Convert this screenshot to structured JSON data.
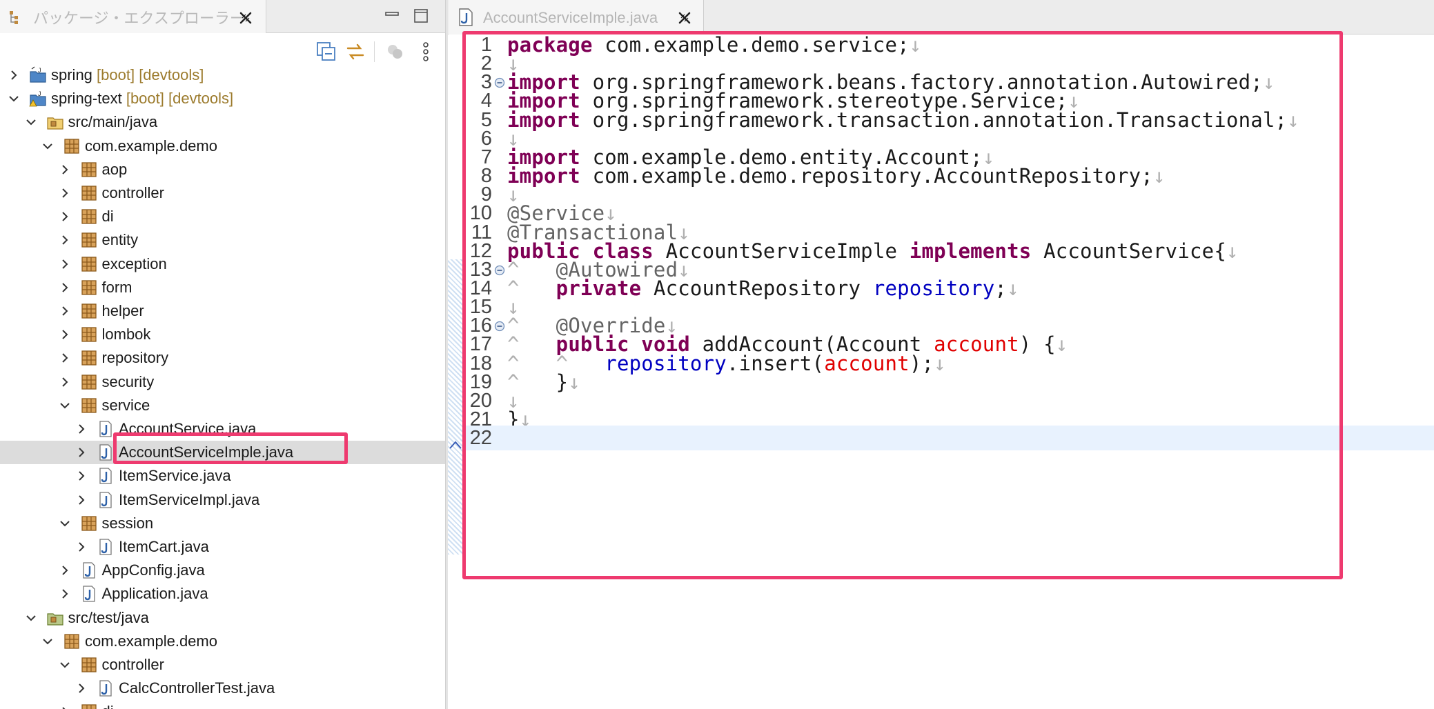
{
  "explorer": {
    "tab_title": "パッケージ・エクスプローラー",
    "tree": [
      {
        "label": "spring",
        "decor": " [boot] [devtools]",
        "indent": 0,
        "state": "collapsed",
        "icon": "project-icon",
        "kind": "project"
      },
      {
        "label": "spring-text",
        "decor": " [boot] [devtools]",
        "indent": 0,
        "state": "expanded",
        "icon": "project-warning-icon",
        "kind": "project"
      },
      {
        "label": "src/main/java",
        "decor": "",
        "indent": 1,
        "state": "expanded",
        "icon": "source-folder-icon",
        "kind": "folder"
      },
      {
        "label": "com.example.demo",
        "decor": "",
        "indent": 2,
        "state": "expanded",
        "icon": "package-icon",
        "kind": "package"
      },
      {
        "label": "aop",
        "decor": "",
        "indent": 3,
        "state": "collapsed",
        "icon": "package-icon",
        "kind": "package"
      },
      {
        "label": "controller",
        "decor": "",
        "indent": 3,
        "state": "collapsed",
        "icon": "package-icon",
        "kind": "package"
      },
      {
        "label": "di",
        "decor": "",
        "indent": 3,
        "state": "collapsed",
        "icon": "package-icon",
        "kind": "package"
      },
      {
        "label": "entity",
        "decor": "",
        "indent": 3,
        "state": "collapsed",
        "icon": "package-icon",
        "kind": "package"
      },
      {
        "label": "exception",
        "decor": "",
        "indent": 3,
        "state": "collapsed",
        "icon": "package-icon",
        "kind": "package"
      },
      {
        "label": "form",
        "decor": "",
        "indent": 3,
        "state": "collapsed",
        "icon": "package-icon",
        "kind": "package"
      },
      {
        "label": "helper",
        "decor": "",
        "indent": 3,
        "state": "collapsed",
        "icon": "package-icon",
        "kind": "package"
      },
      {
        "label": "lombok",
        "decor": "",
        "indent": 3,
        "state": "collapsed",
        "icon": "package-icon",
        "kind": "package"
      },
      {
        "label": "repository",
        "decor": "",
        "indent": 3,
        "state": "collapsed",
        "icon": "package-icon",
        "kind": "package"
      },
      {
        "label": "security",
        "decor": "",
        "indent": 3,
        "state": "collapsed",
        "icon": "package-icon",
        "kind": "package"
      },
      {
        "label": "service",
        "decor": "",
        "indent": 3,
        "state": "expanded",
        "icon": "package-icon",
        "kind": "package"
      },
      {
        "label": "AccountService.java",
        "decor": "",
        "indent": 4,
        "state": "collapsed",
        "icon": "java-file-icon",
        "kind": "file"
      },
      {
        "label": "AccountServiceImple.java",
        "decor": "",
        "indent": 4,
        "state": "collapsed",
        "icon": "java-file-icon",
        "kind": "file",
        "selected": true
      },
      {
        "label": "ItemService.java",
        "decor": "",
        "indent": 4,
        "state": "collapsed",
        "icon": "java-file-icon",
        "kind": "file"
      },
      {
        "label": "ItemServiceImpl.java",
        "decor": "",
        "indent": 4,
        "state": "collapsed",
        "icon": "java-file-icon",
        "kind": "file"
      },
      {
        "label": "session",
        "decor": "",
        "indent": 3,
        "state": "expanded",
        "icon": "package-icon",
        "kind": "package"
      },
      {
        "label": "ItemCart.java",
        "decor": "",
        "indent": 4,
        "state": "collapsed",
        "icon": "java-file-icon",
        "kind": "file"
      },
      {
        "label": "AppConfig.java",
        "decor": "",
        "indent": 3,
        "state": "collapsed",
        "icon": "java-file-icon",
        "kind": "file"
      },
      {
        "label": "Application.java",
        "decor": "",
        "indent": 3,
        "state": "collapsed",
        "icon": "java-file-icon",
        "kind": "file"
      },
      {
        "label": "src/test/java",
        "decor": "",
        "indent": 1,
        "state": "expanded",
        "icon": "test-folder-icon",
        "kind": "folder"
      },
      {
        "label": "com.example.demo",
        "decor": "",
        "indent": 2,
        "state": "expanded",
        "icon": "package-icon",
        "kind": "package"
      },
      {
        "label": "controller",
        "decor": "",
        "indent": 3,
        "state": "expanded",
        "icon": "package-icon",
        "kind": "package"
      },
      {
        "label": "CalcControllerTest.java",
        "decor": "",
        "indent": 4,
        "state": "collapsed",
        "icon": "java-file-icon",
        "kind": "file"
      },
      {
        "label": "di",
        "decor": "",
        "indent": 3,
        "state": "collapsed",
        "icon": "package-icon",
        "kind": "package"
      }
    ]
  },
  "editor": {
    "tab_title": "AccountServiceImple.java",
    "current_line": 22,
    "lines": [
      {
        "n": "1",
        "fold": false,
        "tokens": [
          [
            "keyword",
            "package"
          ],
          [
            "plain",
            " com.example.demo.service;"
          ],
          [
            "ws",
            "↓"
          ]
        ]
      },
      {
        "n": "2",
        "fold": false,
        "tokens": [
          [
            "ws",
            "↓"
          ]
        ]
      },
      {
        "n": "3",
        "fold": true,
        "tokens": [
          [
            "keyword",
            "import"
          ],
          [
            "plain",
            " org.springframework.beans.factory.annotation.Autowired;"
          ],
          [
            "ws",
            "↓"
          ]
        ]
      },
      {
        "n": "4",
        "fold": false,
        "tokens": [
          [
            "keyword",
            "import"
          ],
          [
            "plain",
            " org.springframework.stereotype.Service;"
          ],
          [
            "ws",
            "↓"
          ]
        ]
      },
      {
        "n": "5",
        "fold": false,
        "tokens": [
          [
            "keyword",
            "import"
          ],
          [
            "plain",
            " org.springframework.transaction.annotation.Transactional;"
          ],
          [
            "ws",
            "↓"
          ]
        ]
      },
      {
        "n": "6",
        "fold": false,
        "tokens": [
          [
            "ws",
            "↓"
          ]
        ]
      },
      {
        "n": "7",
        "fold": false,
        "tokens": [
          [
            "keyword",
            "import"
          ],
          [
            "plain",
            " com.example.demo.entity.Account;"
          ],
          [
            "ws",
            "↓"
          ]
        ]
      },
      {
        "n": "8",
        "fold": false,
        "tokens": [
          [
            "keyword",
            "import"
          ],
          [
            "plain",
            " com.example.demo.repository.AccountRepository;"
          ],
          [
            "ws",
            "↓"
          ]
        ]
      },
      {
        "n": "9",
        "fold": false,
        "tokens": [
          [
            "ws",
            "↓"
          ]
        ]
      },
      {
        "n": "10",
        "fold": false,
        "tokens": [
          [
            "annotation",
            "@Service"
          ],
          [
            "ws",
            "↓"
          ]
        ]
      },
      {
        "n": "11",
        "fold": false,
        "tokens": [
          [
            "annotation",
            "@Transactional"
          ],
          [
            "ws",
            "↓"
          ]
        ]
      },
      {
        "n": "12",
        "fold": false,
        "tokens": [
          [
            "keyword",
            "public"
          ],
          [
            "plain",
            " "
          ],
          [
            "keyword",
            "class"
          ],
          [
            "plain",
            " AccountServiceImple "
          ],
          [
            "keyword",
            "implements"
          ],
          [
            "plain",
            " AccountService{"
          ],
          [
            "ws",
            "↓"
          ]
        ]
      },
      {
        "n": "13",
        "fold": true,
        "tokens": [
          [
            "ws",
            "^"
          ],
          [
            "plain",
            "   "
          ],
          [
            "annotation",
            "@Autowired"
          ],
          [
            "ws",
            "↓"
          ]
        ]
      },
      {
        "n": "14",
        "fold": false,
        "tokens": [
          [
            "ws",
            "^"
          ],
          [
            "plain",
            "   "
          ],
          [
            "keyword",
            "private"
          ],
          [
            "plain",
            " AccountRepository "
          ],
          [
            "field",
            "repository"
          ],
          [
            "plain",
            ";"
          ],
          [
            "ws",
            "↓"
          ]
        ]
      },
      {
        "n": "15",
        "fold": false,
        "tokens": [
          [
            "ws",
            "↓"
          ]
        ]
      },
      {
        "n": "16",
        "fold": true,
        "tokens": [
          [
            "ws",
            "^"
          ],
          [
            "plain",
            "   "
          ],
          [
            "annotation",
            "@Override"
          ],
          [
            "ws",
            "↓"
          ]
        ]
      },
      {
        "n": "17",
        "fold": false,
        "tokens": [
          [
            "ws",
            "^"
          ],
          [
            "plain",
            "   "
          ],
          [
            "keyword",
            "public"
          ],
          [
            "plain",
            " "
          ],
          [
            "keyword",
            "void"
          ],
          [
            "plain",
            " addAccount(Account "
          ],
          [
            "param",
            "account"
          ],
          [
            "plain",
            ") {"
          ],
          [
            "ws",
            "↓"
          ]
        ]
      },
      {
        "n": "18",
        "fold": false,
        "tokens": [
          [
            "ws",
            "^"
          ],
          [
            "plain",
            "   "
          ],
          [
            "ws",
            "^"
          ],
          [
            "plain",
            "   "
          ],
          [
            "field",
            "repository"
          ],
          [
            "plain",
            ".insert("
          ],
          [
            "param",
            "account"
          ],
          [
            "plain",
            ");"
          ],
          [
            "ws",
            "↓"
          ]
        ]
      },
      {
        "n": "19",
        "fold": false,
        "tokens": [
          [
            "ws",
            "^"
          ],
          [
            "plain",
            "   }"
          ],
          [
            "ws",
            "↓"
          ]
        ]
      },
      {
        "n": "20",
        "fold": false,
        "tokens": [
          [
            "ws",
            "↓"
          ]
        ]
      },
      {
        "n": "21",
        "fold": false,
        "tokens": [
          [
            "plain",
            "}"
          ],
          [
            "ws",
            "↓"
          ]
        ]
      },
      {
        "n": "22",
        "fold": false,
        "tokens": []
      }
    ]
  },
  "colors": {
    "highlight_border": "#ee3a6f",
    "keyword": "#7f0055",
    "annotation": "#646464",
    "field": "#0000c0",
    "parameter": "#e00000",
    "selected_row": "#dcdcdc",
    "current_line": "#e8f2fe"
  }
}
